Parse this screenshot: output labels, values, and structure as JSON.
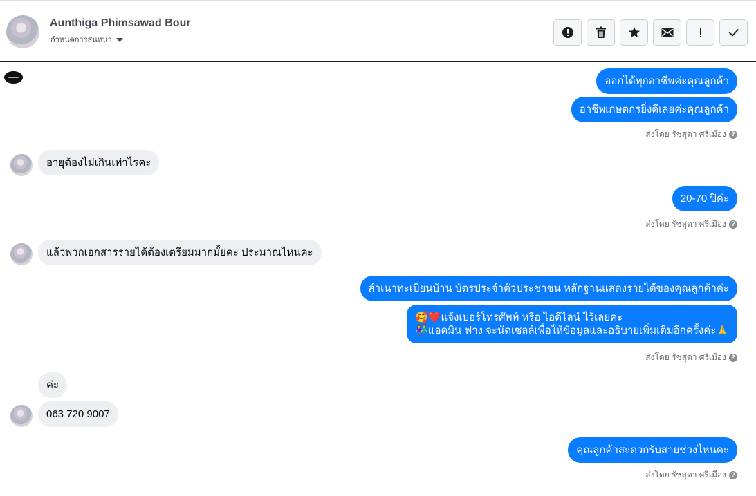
{
  "header": {
    "contact_name": "Aunthiga Phimsawad Bour",
    "assign_label": "กำหนดการสนทนา",
    "buttons": [
      {
        "name": "spam-button",
        "icon": "alert-circle-icon"
      },
      {
        "name": "delete-button",
        "icon": "trash-icon"
      },
      {
        "name": "star-button",
        "icon": "star-icon"
      },
      {
        "name": "mark-unread-button",
        "icon": "envelope-icon"
      },
      {
        "name": "important-button",
        "icon": "exclamation-icon"
      },
      {
        "name": "mark-done-button",
        "icon": "check-icon"
      }
    ]
  },
  "messages": {
    "m1": "ออกได้ทุกอาชีพค่ะคุณลูกค้า",
    "m2": "อาชีพเกษตกรยิ่งดีเลยค่ะคุณลูกค้า",
    "m3": "อายุต้องไม่เกินเท่าไรคะ",
    "m4": "20-70 ปีค่ะ",
    "m5": "แล้วพวกเอกสารรายได้ต้องเตรียมมากมั้ยคะ ประมาณไหนคะ",
    "m6": "สำเนาทะเบียนบ้าน บัตรประจำตัวประชาชน หลักฐานแสดงรายได้ของคุณลูกค้าค่ะ",
    "m7_line1": "🥰❤️แจ้งเบอร์โทรศัพท์ หรือ ไอดีไลน์  ไว้เลยค่ะ",
    "m7_line2": "👫แอดมิน ฟาง จะนัดเซลล์เพื่อให้ข้อมูลและอธิบายเพิ่มเติมอีกครั้งค่ะ🙏",
    "m8": "ค่ะ",
    "m9": "063 720 9007",
    "m10": "คุณลูกค้าสะดวกรับสายช่วงไหนคะ"
  },
  "sent_by": "ส่งโดย รัชสุดา ศรีเมือง",
  "colors": {
    "outgoing": "#0a7cff",
    "incoming": "#eeeff2"
  }
}
